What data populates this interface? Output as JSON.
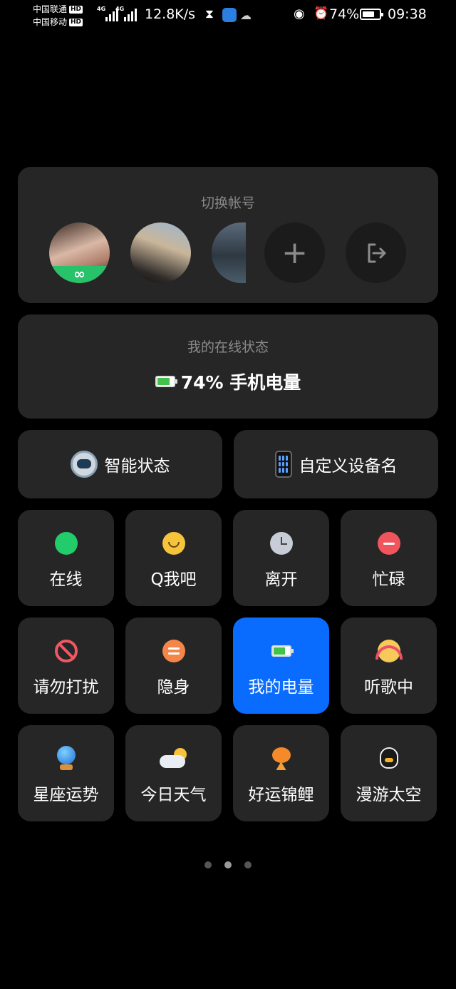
{
  "status_bar": {
    "carrier_1": "中国联通",
    "carrier_2": "中国移动",
    "hd": "HD",
    "net_type_1": "4G",
    "net_type_2": "4G",
    "net_speed": "12.8K/s",
    "battery_percent": "74%",
    "battery_level": 0.74,
    "time": "09:38"
  },
  "account_switch": {
    "title": "切换帐号",
    "accounts": [
      {
        "avatar": "avatar-1",
        "badge": "∞"
      },
      {
        "avatar": "avatar-2"
      },
      {
        "avatar": "avatar-3"
      }
    ],
    "add_icon": "plus-icon",
    "logout_icon": "logout-icon"
  },
  "online_status": {
    "title": "我的在线状态",
    "current": "74% 手机电量",
    "icon": "battery-icon",
    "battery_level": 0.74
  },
  "quick_buttons": [
    {
      "label": "智能状态",
      "icon": "robot-icon"
    },
    {
      "label": "自定义设备名",
      "icon": "phone-icon"
    }
  ],
  "status_tiles": [
    {
      "label": "在线",
      "icon": "green-dot-icon"
    },
    {
      "label": "Q我吧",
      "icon": "smile-icon"
    },
    {
      "label": "离开",
      "icon": "clock-icon"
    },
    {
      "label": "忙碌",
      "icon": "busy-icon"
    },
    {
      "label": "请勿打扰",
      "icon": "no-entry-icon"
    },
    {
      "label": "隐身",
      "icon": "invisible-icon"
    },
    {
      "label": "我的电量",
      "icon": "battery-icon",
      "active": true
    },
    {
      "label": "听歌中",
      "icon": "headphones-icon"
    },
    {
      "label": "星座运势",
      "icon": "crystal-ball-icon"
    },
    {
      "label": "今日天气",
      "icon": "weather-icon"
    },
    {
      "label": "好运锦鲤",
      "icon": "koi-fish-icon"
    },
    {
      "label": "漫游太空",
      "icon": "astronaut-penguin-icon"
    }
  ],
  "pager": {
    "total": 3,
    "current": 2
  },
  "colors": {
    "background": "#000000",
    "card": "#262626",
    "active_tile": "#0a6cff",
    "muted_text": "#8a8a8a"
  }
}
